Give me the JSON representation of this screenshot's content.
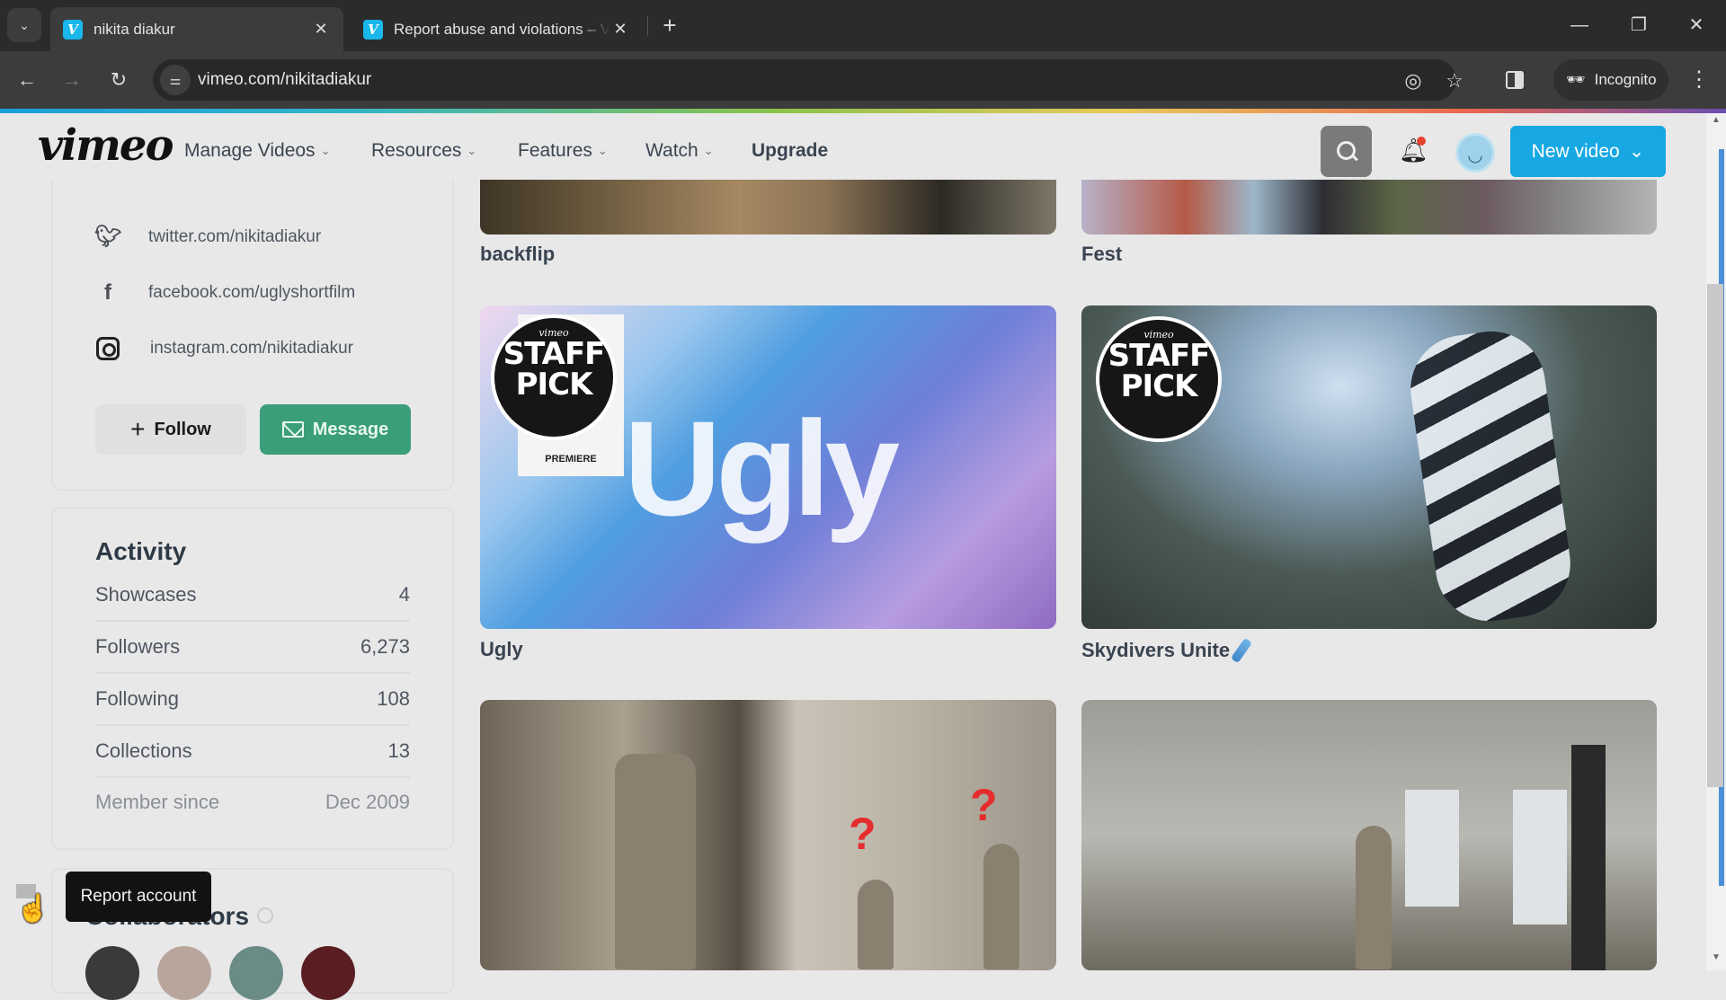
{
  "browser": {
    "tabs": [
      {
        "title": "nikita diakur",
        "favicon": "vimeo-v",
        "active": true
      },
      {
        "title": "Report abuse and violations – Vimeo",
        "favicon": "vimeo-v",
        "active": false
      }
    ],
    "new_tab_label": "+",
    "url": "vimeo.com/nikitadiakur",
    "profile_label": "Incognito",
    "icons": {
      "back": "←",
      "forward": "→",
      "reload": "↻",
      "tab_search": "⌄",
      "close": "✕",
      "minimize": "—",
      "restore": "❐",
      "window_close": "✕",
      "tracking": "◎",
      "bookmark": "☆",
      "menu": "⋮",
      "site_info": "⚌"
    }
  },
  "header": {
    "logo": "vimeo",
    "nav": [
      {
        "label": "Manage Videos",
        "has_dropdown": true
      },
      {
        "label": "Resources",
        "has_dropdown": true
      },
      {
        "label": "Features",
        "has_dropdown": true
      },
      {
        "label": "Watch",
        "has_dropdown": true
      },
      {
        "label": "Upgrade",
        "has_dropdown": false
      }
    ],
    "chevron": "⌄",
    "new_video_label": "New video",
    "notification_dot": true,
    "bell_icon": "🔔︎"
  },
  "sidebar": {
    "links": [
      {
        "icon": "twitter-icon",
        "glyph": "🐦︎",
        "text": "twitter.com/nikitadiakur"
      },
      {
        "icon": "facebook-icon",
        "glyph": "f",
        "text": "facebook.com/uglyshortfilm"
      },
      {
        "icon": "instagram-icon",
        "glyph": "",
        "text": "instagram.com/nikitadiakur"
      }
    ],
    "follow_label": "Follow",
    "follow_icon": "+",
    "message_label": "Message",
    "activity": {
      "title": "Activity",
      "stats": [
        {
          "label": "Showcases",
          "value": "4"
        },
        {
          "label": "Followers",
          "value": "6,273"
        },
        {
          "label": "Following",
          "value": "108"
        },
        {
          "label": "Collections",
          "value": "13"
        },
        {
          "label": "Member since",
          "value": "Dec 2009"
        }
      ]
    },
    "collaborators_title": "Collaborators",
    "tooltip": "Report account",
    "cursor": "☝"
  },
  "videos": [
    {
      "title": "backflip"
    },
    {
      "title": "Fest"
    },
    {
      "title": "Ugly",
      "badge": {
        "brand": "vimeo",
        "line1": "STAFF",
        "line2": "PICK",
        "ribbon": "PREMIERE"
      },
      "thumb_text": "Ugly"
    },
    {
      "title": "Skydivers Unite",
      "badge": {
        "brand": "vimeo",
        "line1": "STAFF",
        "line2": "PICK"
      },
      "has_pencil": true
    },
    {
      "title": "",
      "overlay": [
        "?",
        "?"
      ]
    },
    {
      "title": ""
    }
  ],
  "colors": {
    "accent_blue": "#17a8e3",
    "message_green": "#3a9e78",
    "notification_red": "#e8412f",
    "page_bg": "#e8e8e9"
  }
}
